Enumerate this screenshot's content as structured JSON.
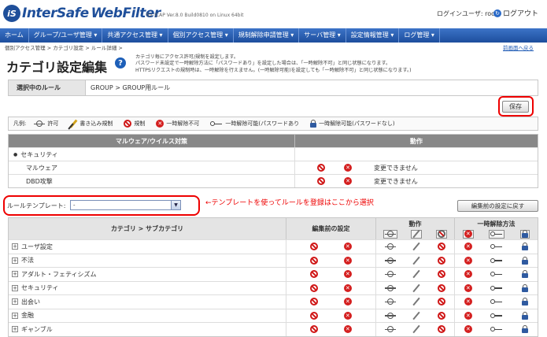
{
  "header": {
    "logo_text_1": "InterSafe",
    "logo_text_2": "WebFilter",
    "version": "for ICAP Ver.8.0 Build0810 on Linux 64bit",
    "login_user": "ログインユーザ: root",
    "logout": "ログアウト"
  },
  "nav": [
    "ホーム",
    "グループ/ユーザ管理 ▾",
    "共通アクセス管理 ▾",
    "個別アクセス管理 ▾",
    "規制解除申請管理 ▾",
    "サーバ管理 ▾",
    "設定情報管理 ▾",
    "ログ管理 ▾"
  ],
  "breadcrumb": "個別アクセス管理 > カテゴリ設定 > ルール詳細 >",
  "help_link": "前画面へ戻る",
  "page_title": "カテゴリ設定編集",
  "description": [
    "カテゴリ毎にアクセス許可/規制を設定します。",
    "パスワード未設定で一時解除方法に「パスワードあり」を設定した場合は、「一時解除不可」と同じ状態になります。",
    "HTTPSリクエストの規制時は、一時解除を行えません。(一時解除可能)を設定しても「一時解除不可」と同じ状態になります。)"
  ],
  "rule": {
    "label": "選択中のルール",
    "value": "GROUP > GROUP用ルール"
  },
  "save_label": "保存",
  "legend": {
    "lead": "凡例:",
    "items": [
      "許可",
      "書き込み規制",
      "規制",
      "一時解除不可",
      "一時解除可能(パスワードあり",
      "一時解除可能(パスワードなし)"
    ]
  },
  "malware": {
    "header_left": "マルウェア/ウイルス対策",
    "header_right": "動作",
    "rows": [
      {
        "name": "セキュリティ",
        "status": ""
      },
      {
        "name": "マルウェア",
        "status": "変更できません"
      },
      {
        "name": "DBD攻撃",
        "status": "変更できません"
      }
    ]
  },
  "template": {
    "label": "ルールテンプレート:",
    "value": "-",
    "annotation": "←テンプレートを使ってルールを登録はここから選択"
  },
  "restore_label": "編集前の設定に戻す",
  "category_table": {
    "col_category": "カテゴリ > サブカテゴリ",
    "col_before": "編集前の設定",
    "col_action": "動作",
    "col_unlock": "一時解除方法",
    "rows": [
      "ユーザ設定",
      "不法",
      "アダルト・フェティシズム",
      "セキュリティ",
      "出会い",
      "金融",
      "ギャンブル"
    ]
  }
}
